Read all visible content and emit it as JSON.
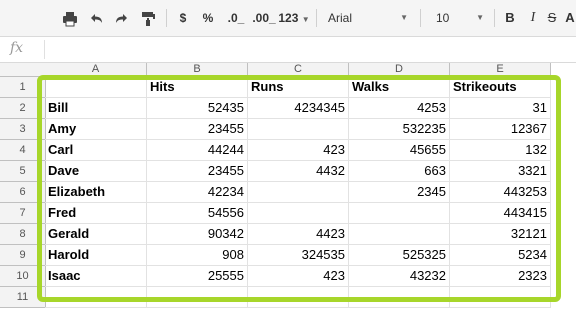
{
  "toolbar": {
    "print_icon": "print-icon",
    "undo_icon": "undo-icon",
    "redo_icon": "redo-icon",
    "paint_format_icon": "paint-format-icon",
    "currency_label": "$",
    "percent_label": "%",
    "decrease_decimal_label": ".0_",
    "increase_decimal_label": ".00_",
    "more_formats_label": "123",
    "font_name": "Arial",
    "font_size": "10",
    "bold_label": "B",
    "italic_label": "I",
    "strikethrough_label": "S",
    "text_color_label": "A"
  },
  "formula_bar": {
    "fx_label": "fx",
    "value": ""
  },
  "sheet": {
    "columns": [
      "A",
      "B",
      "C",
      "D",
      "E"
    ],
    "rows": [
      {
        "num": "1",
        "cells": [
          "",
          "Hits",
          "Runs",
          "Walks",
          "Strikeouts"
        ]
      },
      {
        "num": "2",
        "cells": [
          "Bill",
          "52435",
          "4234345",
          "4253",
          "31"
        ]
      },
      {
        "num": "3",
        "cells": [
          "Amy",
          "23455",
          "",
          "532235",
          "12367"
        ]
      },
      {
        "num": "4",
        "cells": [
          "Carl",
          "44244",
          "423",
          "45655",
          "132"
        ]
      },
      {
        "num": "5",
        "cells": [
          "Dave",
          "23455",
          "4432",
          "663",
          "3321"
        ]
      },
      {
        "num": "6",
        "cells": [
          "Elizabeth",
          "42234",
          "",
          "2345",
          "443253"
        ]
      },
      {
        "num": "7",
        "cells": [
          "Fred",
          "54556",
          "",
          "",
          "443415"
        ]
      },
      {
        "num": "8",
        "cells": [
          "Gerald",
          "90342",
          "4423",
          "",
          "32121"
        ]
      },
      {
        "num": "9",
        "cells": [
          "Harold",
          "908",
          "324535",
          "525325",
          "5234"
        ]
      },
      {
        "num": "10",
        "cells": [
          "Isaac",
          "25555",
          "423",
          "43232",
          "2323"
        ]
      },
      {
        "num": "11",
        "cells": [
          "",
          "",
          "",
          "",
          ""
        ]
      }
    ]
  },
  "colors": {
    "highlight": "#a7d62a"
  }
}
